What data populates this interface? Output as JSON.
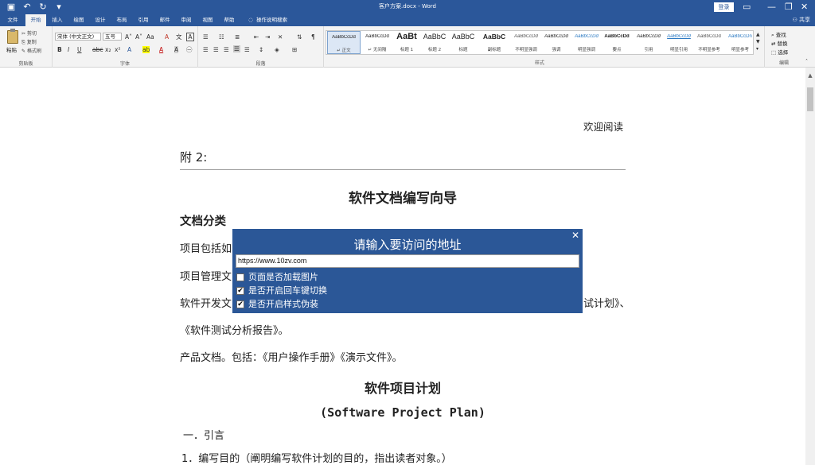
{
  "title_bar": {
    "doc_title": "客户方案.docx  -  Word",
    "login": "登录",
    "icons": [
      "save-icon",
      "undo-icon",
      "redo-icon",
      "customize-qat-icon",
      "ribbon-display-icon",
      "minimize-icon",
      "restore-icon",
      "close-icon"
    ]
  },
  "tabs": [
    "文件",
    "开始",
    "插入",
    "绘图",
    "设计",
    "布局",
    "引用",
    "邮件",
    "审阅",
    "视图",
    "帮助",
    "操作说明搜索"
  ],
  "active_tab": "开始",
  "share": "共享",
  "ribbon": {
    "clipboard": {
      "paste": "粘贴",
      "cut": "剪切",
      "copy": "复制",
      "format_painter": "格式刷",
      "label": "剪贴板"
    },
    "font": {
      "name": "宋体 (中文正文)",
      "size": "五号",
      "label": "字体"
    },
    "paragraph": {
      "label": "段落"
    },
    "styles": {
      "label": "样式",
      "items": [
        {
          "sample": "AaBbCcDd",
          "name": "正文"
        },
        {
          "sample": "AaBbCcDd",
          "name": "无间隔"
        },
        {
          "sample": "AaBt",
          "name": "标题 1"
        },
        {
          "sample": "AaBbC",
          "name": "标题 2"
        },
        {
          "sample": "AaBbC",
          "name": "标题"
        },
        {
          "sample": "AaBbC",
          "name": "副标题"
        },
        {
          "sample": "AaBbCcDd",
          "name": "不明显强调"
        },
        {
          "sample": "AaBbCcDd",
          "name": "强调"
        },
        {
          "sample": "AaBbCcDd",
          "name": "明显强调"
        },
        {
          "sample": "AaBbCcDd",
          "name": "要点"
        },
        {
          "sample": "AaBbCcDd",
          "name": "引用"
        },
        {
          "sample": "AaBbCcDd",
          "name": "明显引用"
        },
        {
          "sample": "AaBbCcDd",
          "name": "不明显参考"
        },
        {
          "sample": "AaBbCcDn",
          "name": "明显参考"
        }
      ]
    },
    "editing": {
      "find": "查找",
      "replace": "替换",
      "select": "选择",
      "label": "编辑"
    }
  },
  "document": {
    "welcome": "欢迎阅读",
    "appendix": "附 2:",
    "title": "软件文档编写向导",
    "section_heading": "文档分类",
    "para1": "项目包括如",
    "para2": "项目管理文",
    "para3_left": "软件开发文",
    "para3_right": "试计划》、",
    "para4": "《软件测试分析报告》。",
    "para5": "产品文档。包括：《用户操作手册》《演示文件》。",
    "plan_title": "软件项目计划",
    "plan_subtitle": "(Software Project Plan)",
    "section1": "一．引言",
    "item1": "1．编写目的（阐明编写软件计划的目的，指出读者对象。）"
  },
  "dialog": {
    "title": "请输入要访问的地址",
    "url": "https://www.10zv.com",
    "options": [
      {
        "label": "页面是否加载图片",
        "checked": false
      },
      {
        "label": "是否开启回车键切换",
        "checked": true
      },
      {
        "label": "是否开启样式伪装",
        "checked": true
      }
    ]
  }
}
